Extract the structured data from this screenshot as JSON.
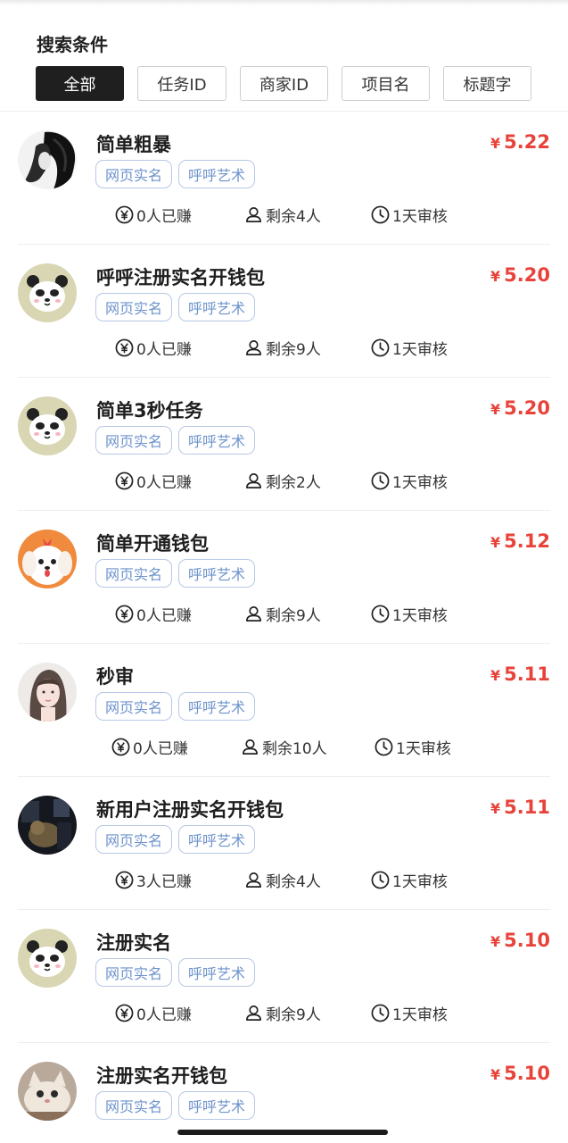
{
  "search": {
    "title": "搜索条件",
    "filters": [
      "全部",
      "任务ID",
      "商家ID",
      "项目名",
      "标题字"
    ]
  },
  "tasks": [
    {
      "title": "简单粗暴",
      "currency": "¥",
      "price": "5.22",
      "tags": [
        "网页实名",
        "呼呼艺术"
      ],
      "earned": "0人已赚",
      "remaining": "剩余4人",
      "review": "1天审核",
      "avatar": "bw-portrait"
    },
    {
      "title": "呼呼注册实名开钱包",
      "currency": "¥",
      "price": "5.20",
      "tags": [
        "网页实名",
        "呼呼艺术"
      ],
      "earned": "0人已赚",
      "remaining": "剩余9人",
      "review": "1天审核",
      "avatar": "panda"
    },
    {
      "title": "简单3秒任务",
      "currency": "¥",
      "price": "5.20",
      "tags": [
        "网页实名",
        "呼呼艺术"
      ],
      "earned": "0人已赚",
      "remaining": "剩余2人",
      "review": "1天审核",
      "avatar": "panda"
    },
    {
      "title": "简单开通钱包",
      "currency": "¥",
      "price": "5.12",
      "tags": [
        "网页实名",
        "呼呼艺术"
      ],
      "earned": "0人已赚",
      "remaining": "剩余9人",
      "review": "1天审核",
      "avatar": "puppy"
    },
    {
      "title": "秒审",
      "currency": "¥",
      "price": "5.11",
      "tags": [
        "网页实名",
        "呼呼艺术"
      ],
      "earned": "0人已赚",
      "remaining": "剩余10人",
      "review": "1天审核",
      "avatar": "girl-portrait"
    },
    {
      "title": "新用户注册实名开钱包",
      "currency": "¥",
      "price": "5.11",
      "tags": [
        "网页实名",
        "呼呼艺术"
      ],
      "earned": "3人已赚",
      "remaining": "剩余4人",
      "review": "1天审核",
      "avatar": "dark-photo"
    },
    {
      "title": "注册实名",
      "currency": "¥",
      "price": "5.10",
      "tags": [
        "网页实名",
        "呼呼艺术"
      ],
      "earned": "0人已赚",
      "remaining": "剩余9人",
      "review": "1天审核",
      "avatar": "panda"
    },
    {
      "title": "注册实名开钱包",
      "currency": "¥",
      "price": "5.10",
      "tags": [
        "网页实名",
        "呼呼艺术"
      ],
      "earned": "",
      "remaining": "",
      "review": "",
      "avatar": "cat-photo"
    }
  ],
  "colors": {
    "price": "#e8433a",
    "tag_text": "#6d93cc",
    "tag_border": "#b6c8e6",
    "active_filter": "#1f1f1f"
  }
}
